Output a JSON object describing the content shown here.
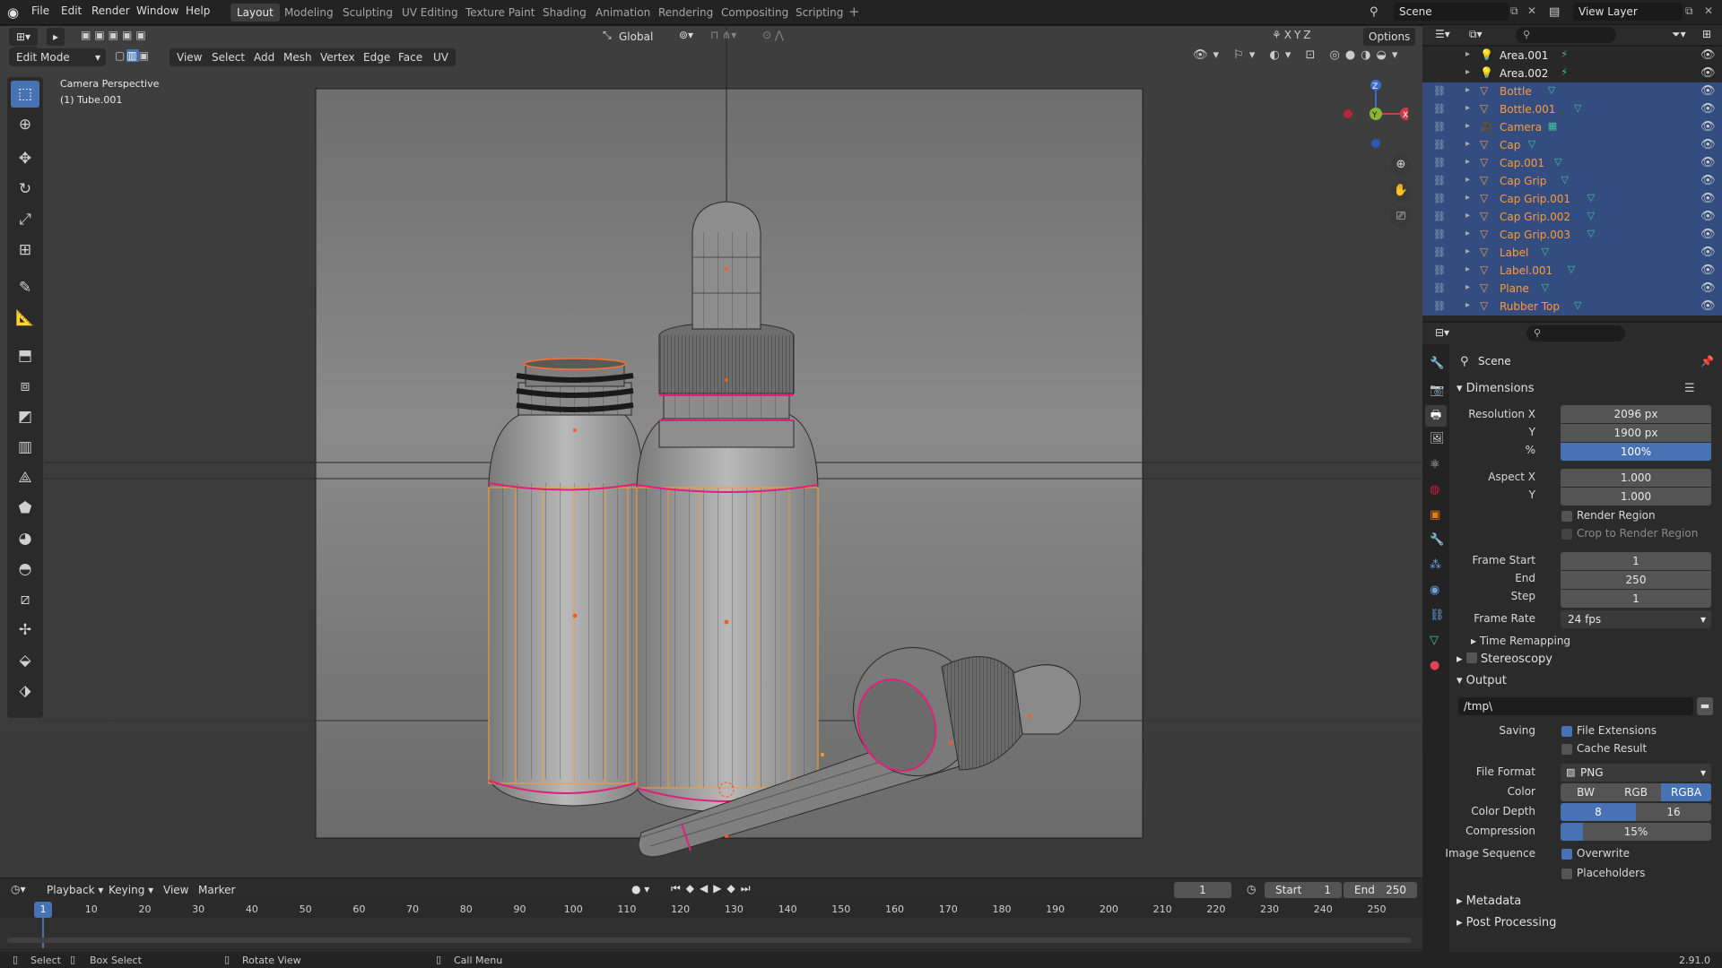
{
  "topbar": {
    "menus": [
      "File",
      "Edit",
      "Render",
      "Window",
      "Help"
    ],
    "workspaces": [
      "Layout",
      "Modeling",
      "Sculpting",
      "UV Editing",
      "Texture Paint",
      "Shading",
      "Animation",
      "Rendering",
      "Compositing",
      "Scripting"
    ],
    "active_workspace": "Layout",
    "scene_name": "Scene",
    "view_layer": "View Layer"
  },
  "viewport_header": {
    "mode": "Edit Mode",
    "menus": [
      "View",
      "Select",
      "Add",
      "Mesh",
      "Vertex",
      "Edge",
      "Face",
      "UV"
    ],
    "orientation": "Global",
    "options": "Options"
  },
  "viewport": {
    "camera_label": "Camera Perspective",
    "object_label": "(1) Tube.001",
    "gizmo_axes": [
      "Z",
      "Y",
      "X"
    ]
  },
  "outliner": {
    "items": [
      {
        "name": "Area.001",
        "type": "light",
        "selected": false
      },
      {
        "name": "Area.002",
        "type": "light",
        "selected": false
      },
      {
        "name": "Bottle",
        "type": "mesh",
        "selected": true
      },
      {
        "name": "Bottle.001",
        "type": "mesh",
        "selected": true
      },
      {
        "name": "Camera",
        "type": "camera",
        "selected": true
      },
      {
        "name": "Cap",
        "type": "mesh",
        "selected": true
      },
      {
        "name": "Cap.001",
        "type": "mesh",
        "selected": true
      },
      {
        "name": "Cap Grip",
        "type": "mesh",
        "selected": true
      },
      {
        "name": "Cap Grip.001",
        "type": "mesh",
        "selected": true
      },
      {
        "name": "Cap Grip.002",
        "type": "mesh",
        "selected": true
      },
      {
        "name": "Cap Grip.003",
        "type": "mesh",
        "selected": true
      },
      {
        "name": "Label",
        "type": "mesh",
        "selected": true
      },
      {
        "name": "Label.001",
        "type": "mesh",
        "selected": true
      },
      {
        "name": "Plane",
        "type": "mesh",
        "selected": true
      },
      {
        "name": "Rubber Top",
        "type": "mesh",
        "selected": true
      }
    ]
  },
  "properties": {
    "context": "Scene",
    "dimensions": {
      "title": "Dimensions",
      "resolution_x_label": "Resolution X",
      "resolution_x": "2096 px",
      "y_label": "Y",
      "resolution_y": "1900 px",
      "percent_label": "%",
      "percent": "100%",
      "aspect_x_label": "Aspect X",
      "aspect_x": "1.000",
      "aspect_y_label": "Y",
      "aspect_y": "1.000",
      "render_region": "Render Region",
      "crop": "Crop to Render Region",
      "frame_start_label": "Frame Start",
      "frame_start": "1",
      "end_label": "End",
      "frame_end": "250",
      "step_label": "Step",
      "step": "1",
      "frame_rate_label": "Frame Rate",
      "frame_rate": "24 fps",
      "time_remapping": "Time Remapping"
    },
    "stereoscopy": "Stereoscopy",
    "output": {
      "title": "Output",
      "path": "/tmp\\",
      "saving_label": "Saving",
      "file_extensions": "File Extensions",
      "cache_result": "Cache Result",
      "file_format_label": "File Format",
      "file_format": "PNG",
      "color_label": "Color",
      "color_modes": [
        "BW",
        "RGB",
        "RGBA"
      ],
      "color_depth_label": "Color Depth",
      "color_depths": [
        "8",
        "16"
      ],
      "compression_label": "Compression",
      "compression": "15%",
      "compression_fraction": 0.15,
      "image_sequence_label": "Image Sequence",
      "overwrite": "Overwrite",
      "placeholders": "Placeholders"
    },
    "metadata": "Metadata",
    "post_processing": "Post Processing"
  },
  "timeline": {
    "menus": [
      "Playback",
      "Keying",
      "View",
      "Marker"
    ],
    "current_frame": "1",
    "start_label": "Start",
    "start": "1",
    "end_label": "End",
    "end": "250",
    "ticks": [
      "10",
      "20",
      "30",
      "40",
      "50",
      "60",
      "70",
      "80",
      "90",
      "100",
      "110",
      "120",
      "130",
      "140",
      "150",
      "160",
      "170",
      "180",
      "190",
      "200",
      "210",
      "220",
      "230",
      "240",
      "250"
    ],
    "playhead": "1"
  },
  "statusbar": {
    "select": "Select",
    "box_select": "Box Select",
    "rotate_view": "Rotate View",
    "call_menu": "Call Menu",
    "version": "2.91.0"
  },
  "colors": {
    "accent": "#4772b3",
    "selected_row": "#334d80",
    "selected_text": "#ff9a3c",
    "edge_seam": "#e0207a",
    "edge_selected": "#ffa033"
  }
}
